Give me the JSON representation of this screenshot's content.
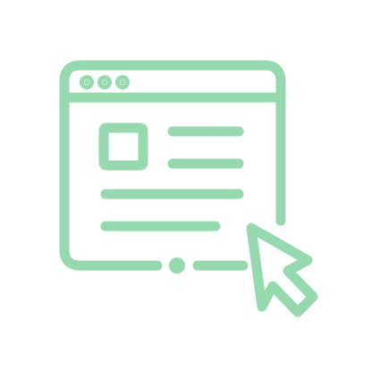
{
  "illustration": {
    "subject": "web-browser-with-cursor",
    "icons": [
      "browser-window-icon",
      "cursor-arrow-icon"
    ],
    "colors": {
      "stroke": "#97d9ae",
      "background": "#ffffff"
    }
  }
}
